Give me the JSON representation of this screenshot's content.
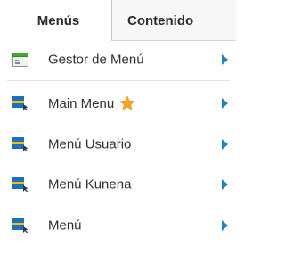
{
  "menubar": {
    "tabs": [
      {
        "label": "Menús"
      },
      {
        "label": "Contenido"
      }
    ]
  },
  "dropdown": {
    "items": [
      {
        "label": "Gestor de Menú",
        "icon": "menu-manager-icon"
      },
      {
        "label": "Main Menu",
        "icon": "menu-icon",
        "badge": "star-icon"
      },
      {
        "label": "Menú Usuario",
        "icon": "menu-icon"
      },
      {
        "label": "Menú Kunena",
        "icon": "menu-icon"
      },
      {
        "label": "Menú",
        "icon": "menu-icon"
      }
    ]
  },
  "colors": {
    "accent": "#1a82c9",
    "star": "#f5a623",
    "menu_icon_blue": "#1d6fc0",
    "menu_icon_yellow": "#f2c200",
    "manager_icon_green": "#4aa52e"
  }
}
